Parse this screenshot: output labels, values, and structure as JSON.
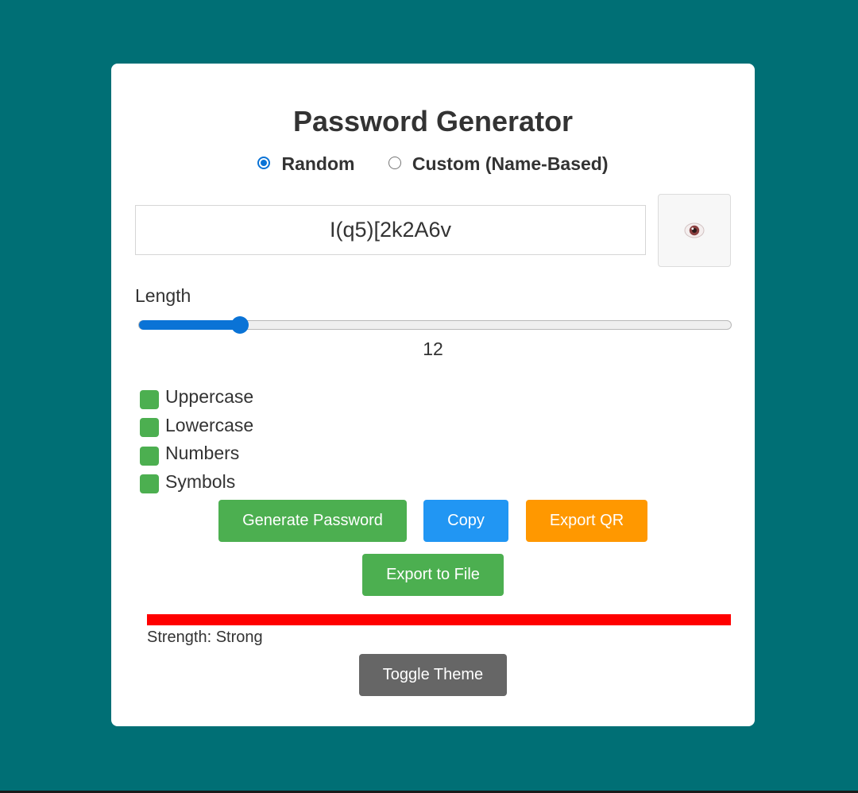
{
  "app": {
    "title": "Password Generator",
    "modes": [
      {
        "label": "Random",
        "selected": true
      },
      {
        "label": "Custom (Name-Based)",
        "selected": false
      }
    ],
    "password": "I(q5)[2k2A6v",
    "visibility_icon": "eye-icon",
    "length": {
      "label": "Length",
      "value": "12",
      "min": 4,
      "max": 64,
      "level": 0.17
    },
    "options": [
      {
        "label": "Uppercase",
        "checked": true
      },
      {
        "label": "Lowercase",
        "checked": true
      },
      {
        "label": "Numbers",
        "checked": true
      },
      {
        "label": "Symbols",
        "checked": true
      }
    ],
    "buttons": {
      "generate": "Generate Password",
      "copy": "Copy",
      "export_qr": "Export QR",
      "export_file": "Export to File",
      "toggle_theme": "Toggle Theme"
    },
    "strength": {
      "text": "Strength: Strong",
      "level": 1.0,
      "color": "#ff0000"
    }
  },
  "colors": {
    "background": "#006f75",
    "accent": "#0a73d6",
    "green": "#4caf50",
    "blue": "#2196f3",
    "orange": "#ff9800",
    "gray": "#666666"
  }
}
